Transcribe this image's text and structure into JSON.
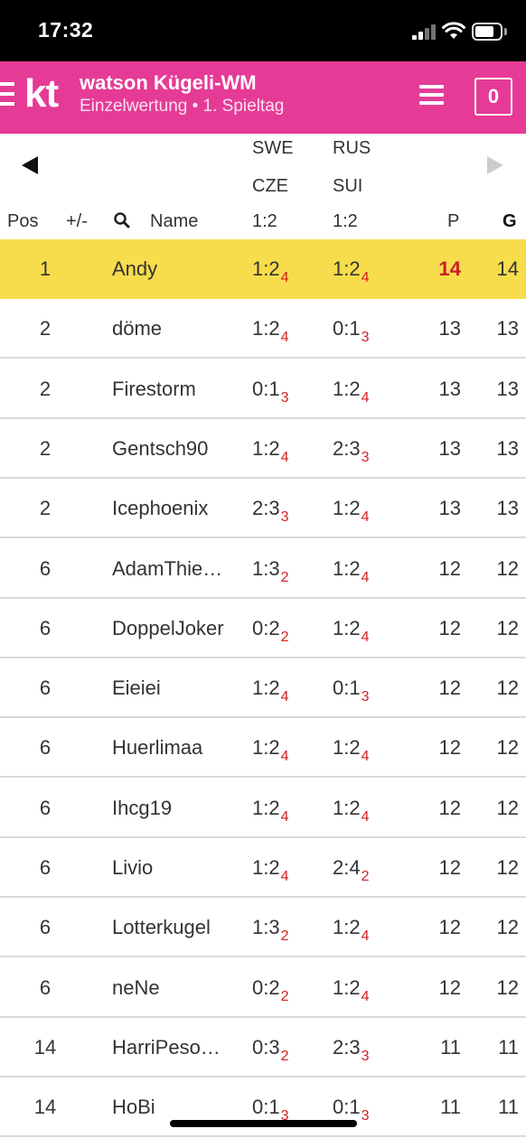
{
  "status_bar": {
    "time": "17:32"
  },
  "header": {
    "logo": "kt",
    "title": "watson Kügeli-WM",
    "subtitle": "Einzelwertung • 1. Spieltag",
    "badge_count": "0"
  },
  "table": {
    "columns": {
      "pos": "Pos",
      "change": "+/-",
      "name": "Name",
      "points": "P",
      "total": "G"
    },
    "game1": {
      "team_a": "SWE",
      "team_b": "CZE",
      "result": "1:2"
    },
    "game2": {
      "team_a": "RUS",
      "team_b": "SUI",
      "result": "1:2"
    },
    "rows": [
      {
        "pos": "1",
        "name": "Andy",
        "g1": "1:2",
        "g1_pts": "4",
        "g2": "1:2",
        "g2_pts": "4",
        "p": "14",
        "g": "14"
      },
      {
        "pos": "2",
        "name": "döme",
        "g1": "1:2",
        "g1_pts": "4",
        "g2": "0:1",
        "g2_pts": "3",
        "p": "13",
        "g": "13"
      },
      {
        "pos": "2",
        "name": "Firestorm",
        "g1": "0:1",
        "g1_pts": "3",
        "g2": "1:2",
        "g2_pts": "4",
        "p": "13",
        "g": "13"
      },
      {
        "pos": "2",
        "name": "Gentsch90",
        "g1": "1:2",
        "g1_pts": "4",
        "g2": "2:3",
        "g2_pts": "3",
        "p": "13",
        "g": "13"
      },
      {
        "pos": "2",
        "name": "Icephoenix",
        "g1": "2:3",
        "g1_pts": "3",
        "g2": "1:2",
        "g2_pts": "4",
        "p": "13",
        "g": "13"
      },
      {
        "pos": "6",
        "name": "AdamThie…",
        "g1": "1:3",
        "g1_pts": "2",
        "g2": "1:2",
        "g2_pts": "4",
        "p": "12",
        "g": "12"
      },
      {
        "pos": "6",
        "name": "DoppelJoker",
        "g1": "0:2",
        "g1_pts": "2",
        "g2": "1:2",
        "g2_pts": "4",
        "p": "12",
        "g": "12"
      },
      {
        "pos": "6",
        "name": "Eieiei",
        "g1": "1:2",
        "g1_pts": "4",
        "g2": "0:1",
        "g2_pts": "3",
        "p": "12",
        "g": "12"
      },
      {
        "pos": "6",
        "name": "Huerlimaa",
        "g1": "1:2",
        "g1_pts": "4",
        "g2": "1:2",
        "g2_pts": "4",
        "p": "12",
        "g": "12"
      },
      {
        "pos": "6",
        "name": "Ihcg19",
        "g1": "1:2",
        "g1_pts": "4",
        "g2": "1:2",
        "g2_pts": "4",
        "p": "12",
        "g": "12"
      },
      {
        "pos": "6",
        "name": "Livio",
        "g1": "1:2",
        "g1_pts": "4",
        "g2": "2:4",
        "g2_pts": "2",
        "p": "12",
        "g": "12"
      },
      {
        "pos": "6",
        "name": "Lotterkugel",
        "g1": "1:3",
        "g1_pts": "2",
        "g2": "1:2",
        "g2_pts": "4",
        "p": "12",
        "g": "12"
      },
      {
        "pos": "6",
        "name": "neNe",
        "g1": "0:2",
        "g1_pts": "2",
        "g2": "1:2",
        "g2_pts": "4",
        "p": "12",
        "g": "12"
      },
      {
        "pos": "14",
        "name": "HarriPeso…",
        "g1": "0:3",
        "g1_pts": "2",
        "g2": "2:3",
        "g2_pts": "3",
        "p": "11",
        "g": "11"
      },
      {
        "pos": "14",
        "name": "HoBi",
        "g1": "0:1",
        "g1_pts": "3",
        "g2": "0:1",
        "g2_pts": "3",
        "p": "11",
        "g": "11"
      }
    ]
  },
  "colors": {
    "brand_pink": "#e53b96",
    "highlight_yellow": "#f7dc4c",
    "points_red": "#d32020"
  }
}
